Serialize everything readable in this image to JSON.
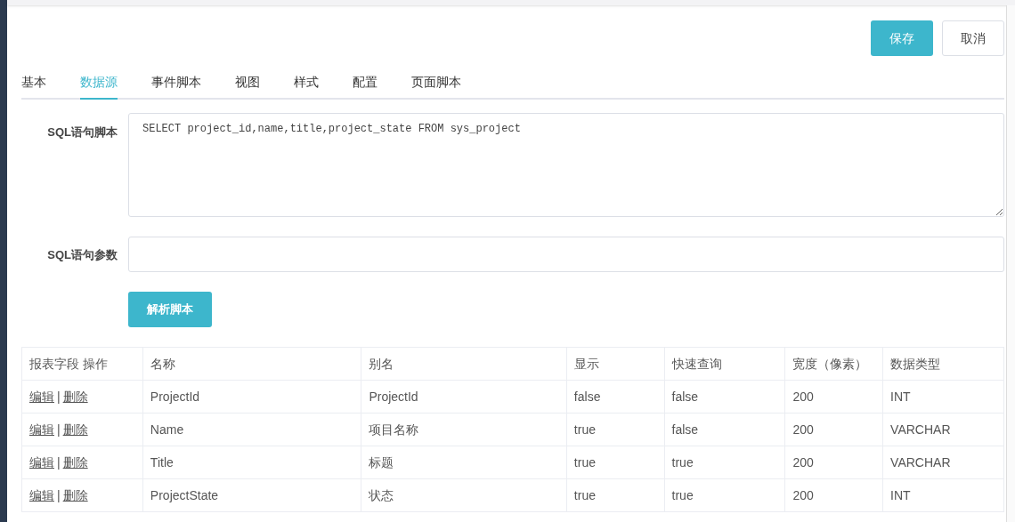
{
  "buttons": [
    {
      "label": "保存",
      "kind": "primary"
    },
    {
      "label": "取消",
      "kind": "default"
    }
  ],
  "tabs": [
    {
      "label": "基本",
      "selected": false
    },
    {
      "label": "数据源",
      "selected": true
    },
    {
      "label": "事件脚本",
      "selected": false
    },
    {
      "label": "视图",
      "selected": false
    },
    {
      "label": "样式",
      "selected": false
    },
    {
      "label": "配置",
      "selected": false
    },
    {
      "label": "页面脚本",
      "selected": false
    }
  ],
  "form": {
    "sql_script": {
      "label": "SQL语句脚本",
      "value": "SELECT project_id,name,title,project_state FROM sys_project"
    },
    "sql_params": {
      "label": "SQL语句参数"
    },
    "parse_button": "解析脚本"
  },
  "table": {
    "columns": [
      "报表字段 操作",
      "名称",
      "别名",
      "显示",
      "快速查询",
      "宽度（像素）",
      "数据类型"
    ],
    "rows": [
      {
        "cells": [
          {
            "links": [
              "编辑",
              "删除"
            ],
            "separator": "|"
          },
          "ProjectId",
          "ProjectId",
          "false",
          "false",
          "200",
          "INT"
        ]
      },
      {
        "cells": [
          {
            "links": [
              "编辑",
              "删除"
            ],
            "separator": "|"
          },
          "Name",
          "项目名称",
          "true",
          "false",
          "200",
          "VARCHAR"
        ]
      },
      {
        "cells": [
          {
            "links": [
              "编辑",
              "删除"
            ],
            "separator": "|"
          },
          "Title",
          "标题",
          "true",
          "true",
          "200",
          "VARCHAR"
        ]
      },
      {
        "cells": [
          {
            "links": [
              "编辑",
              "删除"
            ],
            "separator": "|"
          },
          "ProjectState",
          "状态",
          "true",
          "true",
          "200",
          "INT"
        ]
      }
    ]
  }
}
